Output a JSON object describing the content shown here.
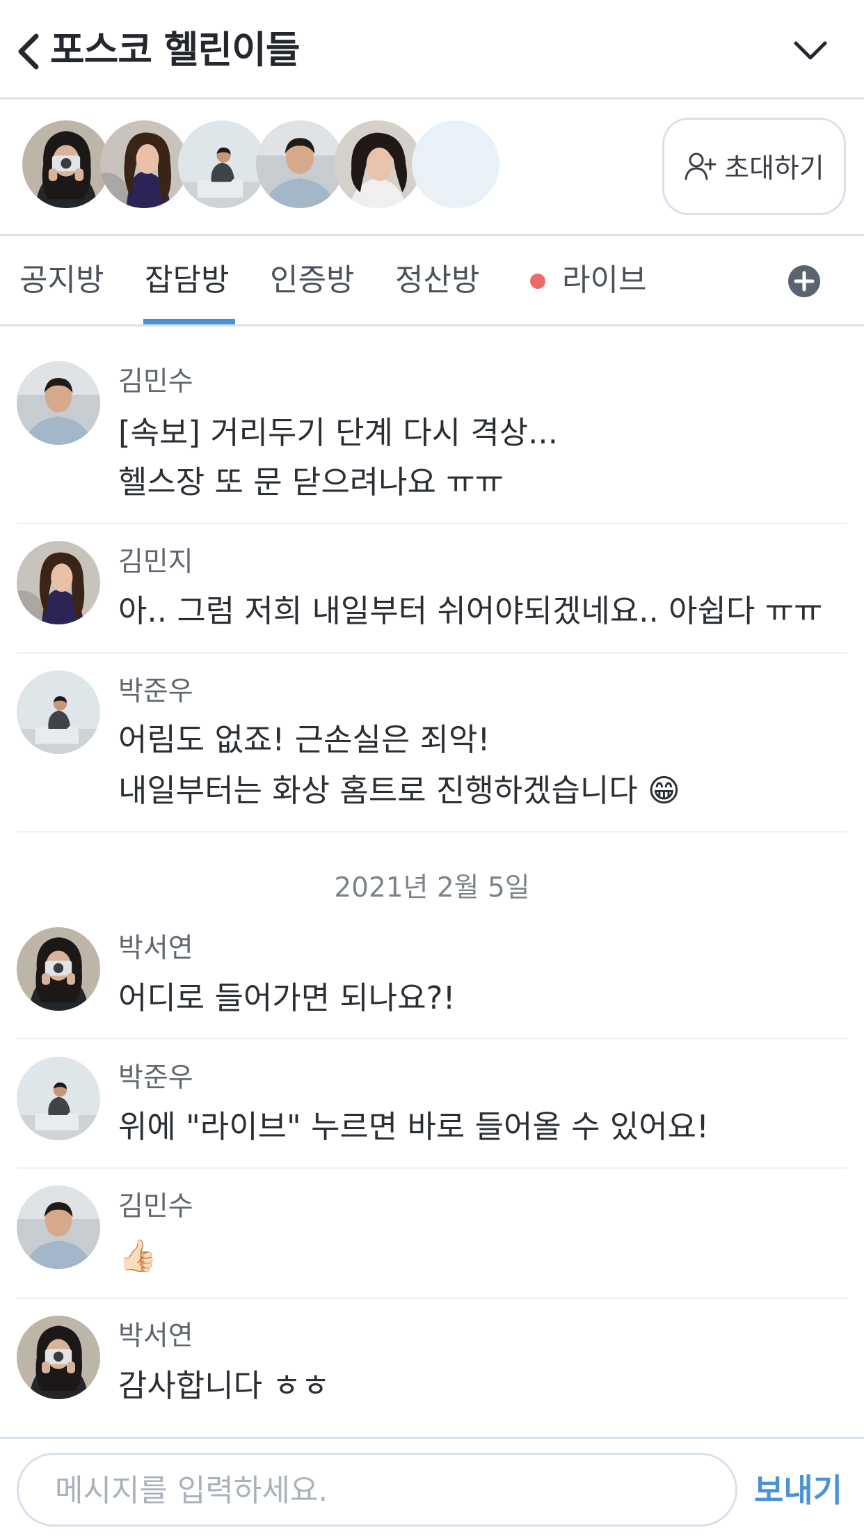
{
  "header": {
    "title": "포스코 헬린이들"
  },
  "members": {
    "invite_label": "초대하기"
  },
  "tabs": [
    "공지방",
    "잡담방",
    "인증방",
    "정산방",
    "라이브"
  ],
  "active_tab": "잡담방",
  "colors": {
    "accent": "#4a92d6",
    "live_dot": "#ee6a6a",
    "divider": "#d8e2ec"
  },
  "messages": [
    {
      "sender": "김민수",
      "lines": [
        "[속보] 거리두기 단계 다시 격상...",
        "헬스장 또 문 닫으려나요 ㅠㅠ"
      ]
    },
    {
      "sender": "김민지",
      "lines": [
        "아.. 그럼 저희 내일부터 쉬어야되겠네요.. 아쉽다 ㅠㅠ"
      ]
    },
    {
      "sender": "박준우",
      "lines": [
        "어림도 없죠! 근손실은 죄악!",
        "내일부터는 화상 홈트로 진행하겠습니다 😁"
      ]
    },
    {
      "sender": "박서연",
      "lines": [
        "어디로 들어가면 되나요?!"
      ]
    },
    {
      "sender": "박준우",
      "lines": [
        "위에 \"라이브\" 누르면 바로 들어올 수 있어요!"
      ]
    },
    {
      "sender": "김민수",
      "lines": [
        "👍🏻"
      ]
    },
    {
      "sender": "박서연",
      "lines": [
        "감사합니다 ㅎㅎ"
      ]
    }
  ],
  "date_separator": "2021년 2월 5일",
  "composer": {
    "placeholder": "메시지를 입력하세요.",
    "send_label": "보내기"
  }
}
